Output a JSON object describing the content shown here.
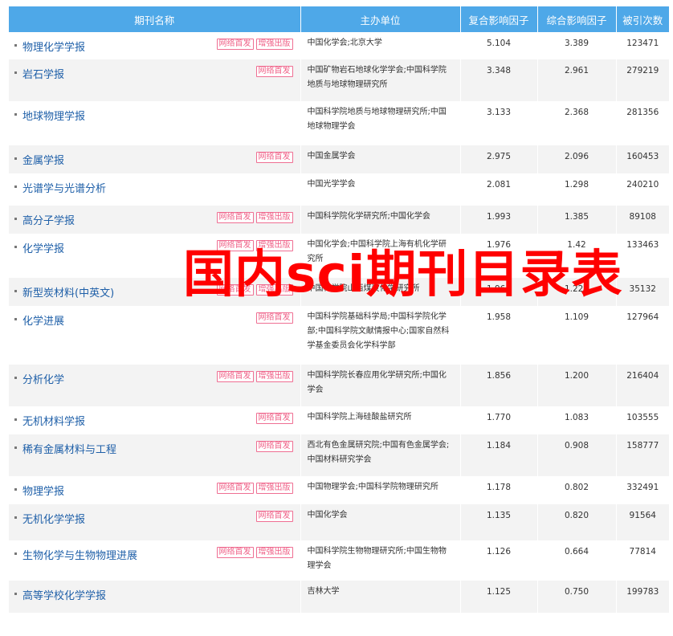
{
  "headers": {
    "name": "期刊名称",
    "org": "主办单位",
    "fuhe": "复合影响因子",
    "zonghe": "综合影响因子",
    "cited": "被引次数"
  },
  "tags": {
    "online": "网络首发",
    "enhanced": "增强出版"
  },
  "overlay_title": "国内sci期刊目录表",
  "rows": [
    {
      "name": "物理化学学报",
      "org": "中国化学会;北京大学",
      "fuhe": "5.104",
      "zonghe": "3.389",
      "cited": "123471",
      "online": true,
      "enhanced": true
    },
    {
      "name": "岩石学报",
      "org": "中国矿物岩石地球化学学会;中国科学院地质与地球物理研究所",
      "fuhe": "3.348",
      "zonghe": "2.961",
      "cited": "279219",
      "online": true,
      "enhanced": false
    },
    {
      "name": "地球物理学报",
      "org": "中国科学院地质与地球物理研究所;中国地球物理学会",
      "fuhe": "3.133",
      "zonghe": "2.368",
      "cited": "281356",
      "online": false,
      "enhanced": false
    },
    {
      "name": "金属学报",
      "org": "中国金属学会",
      "fuhe": "2.975",
      "zonghe": "2.096",
      "cited": "160453",
      "online": true,
      "enhanced": false
    },
    {
      "name": "光谱学与光谱分析",
      "org": "中国光学学会",
      "fuhe": "2.081",
      "zonghe": "1.298",
      "cited": "240210",
      "online": false,
      "enhanced": false
    },
    {
      "name": "高分子学报",
      "org": "中国科学院化学研究所;中国化学会",
      "fuhe": "1.993",
      "zonghe": "1.385",
      "cited": "89108",
      "online": true,
      "enhanced": true
    },
    {
      "name": "化学学报",
      "org": "中国化学会;中国科学院上海有机化学研究所",
      "fuhe": "1.976",
      "zonghe": "1.42",
      "cited": "133463",
      "online": true,
      "enhanced": true
    },
    {
      "name": "新型炭材料(中英文)",
      "org": "中国科学院山西煤炭化学研究所",
      "fuhe": "1.964",
      "zonghe": "1.225",
      "cited": "35132",
      "online": true,
      "enhanced": true
    },
    {
      "name": "化学进展",
      "org": "中国科学院基础科学局;中国科学院化学部;中国科学院文献情报中心;国家自然科学基金委员会化学科学部",
      "fuhe": "1.958",
      "zonghe": "1.109",
      "cited": "127964",
      "online": true,
      "enhanced": false
    },
    {
      "name": "分析化学",
      "org": "中国科学院长春应用化学研究所;中国化学会",
      "fuhe": "1.856",
      "zonghe": "1.200",
      "cited": "216404",
      "online": true,
      "enhanced": true
    },
    {
      "name": "无机材料学报",
      "org": "中国科学院上海硅酸盐研究所",
      "fuhe": "1.770",
      "zonghe": "1.083",
      "cited": "103555",
      "online": true,
      "enhanced": false
    },
    {
      "name": "稀有金属材料与工程",
      "org": "西北有色金属研究院;中国有色金属学会;中国材料研究学会",
      "fuhe": "1.184",
      "zonghe": "0.908",
      "cited": "158777",
      "online": true,
      "enhanced": false
    },
    {
      "name": "物理学报",
      "org": "中国物理学会;中国科学院物理研究所",
      "fuhe": "1.178",
      "zonghe": "0.802",
      "cited": "332491",
      "online": true,
      "enhanced": true
    },
    {
      "name": "无机化学学报",
      "org": "中国化学会",
      "fuhe": "1.135",
      "zonghe": "0.820",
      "cited": "91564",
      "online": true,
      "enhanced": false
    },
    {
      "name": "生物化学与生物物理进展",
      "org": "中国科学院生物物理研究所;中国生物物理学会",
      "fuhe": "1.126",
      "zonghe": "0.664",
      "cited": "77814",
      "online": true,
      "enhanced": true
    },
    {
      "name": "高等学校化学学报",
      "org": "吉林大学",
      "fuhe": "1.125",
      "zonghe": "0.750",
      "cited": "199783",
      "online": false,
      "enhanced": false
    }
  ]
}
